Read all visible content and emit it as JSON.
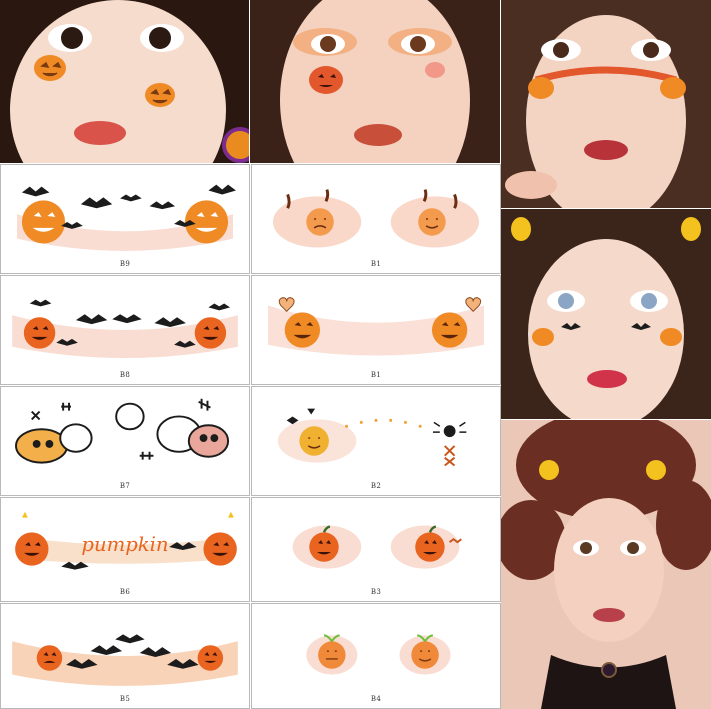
{
  "stickers": [
    {
      "code": "B9",
      "motif": "pumpkins-with-bats"
    },
    {
      "code": "B1",
      "motif": "small-pumpkins-with-leaves"
    },
    {
      "code": "B8",
      "motif": "pumpkins-with-bat-row"
    },
    {
      "code": "B1",
      "motif": "pumpkins-with-hearts"
    },
    {
      "code": "B7",
      "motif": "doodle-skulls-and-stitches"
    },
    {
      "code": "B2",
      "motif": "pumpkin-and-spider-dots"
    },
    {
      "code": "B6",
      "motif": "pumpkin-lettering-band"
    },
    {
      "code": "B3",
      "motif": "simple-pumpkins"
    },
    {
      "code": "B5",
      "motif": "pumpkins-with-bats-band"
    },
    {
      "code": "B4",
      "motif": "mini-pumpkins"
    }
  ],
  "lettering": {
    "band_word": "pumpkin"
  },
  "photos": [
    {
      "id": "photo-1",
      "motif": "pumpkin-cheek-stickers"
    },
    {
      "id": "photo-2",
      "motif": "pumpkin-eye-makeup"
    },
    {
      "id": "photo-3",
      "motif": "pumpkin-word-band"
    },
    {
      "id": "photo-4",
      "motif": "bat-and-pumpkin-makeup"
    },
    {
      "id": "photo-5",
      "motif": "halloween-styled-portrait"
    }
  ],
  "colors": {
    "pumpkin": "#f08a24",
    "pumpkin_dark": "#c9561a",
    "blush": "#f6c7b4",
    "bat": "#1c1c1c",
    "stem": "#3a6b2a",
    "skin": "#f3d6c6",
    "hair": "#3b241a"
  }
}
